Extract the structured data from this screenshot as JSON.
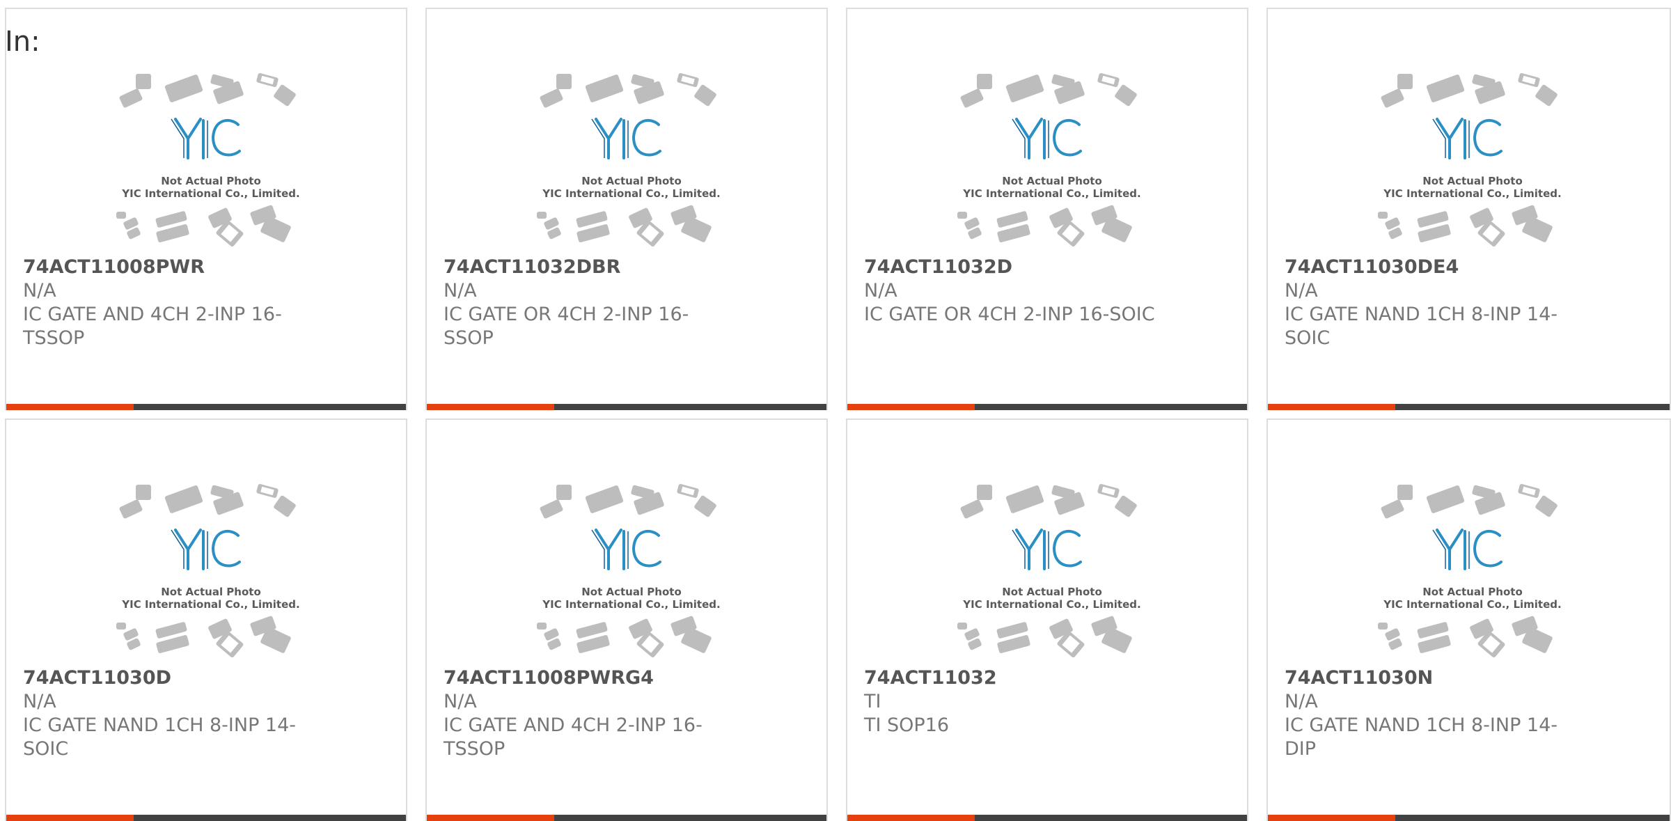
{
  "header": {
    "label": "In:"
  },
  "photo": {
    "logo_text": "YIC",
    "line1": "Not Actual Photo",
    "line2": "YIC International Co., Limited."
  },
  "colors": {
    "accent": "#e6400f",
    "bar": "#424242",
    "logo_blue": "#2a8fc4",
    "chip_gray": "#bdbdbd"
  },
  "products": [
    {
      "part_number": "74ACT11008PWR",
      "manufacturer": "N/A",
      "description": "IC GATE AND 4CH 2-INP 16-TSSOP"
    },
    {
      "part_number": "74ACT11032DBR",
      "manufacturer": "N/A",
      "description": "IC GATE OR 4CH 2-INP 16-SSOP"
    },
    {
      "part_number": "74ACT11032D",
      "manufacturer": "N/A",
      "description": "IC GATE OR 4CH 2-INP 16-SOIC"
    },
    {
      "part_number": "74ACT11030DE4",
      "manufacturer": "N/A",
      "description": "IC GATE NAND 1CH 8-INP 14-SOIC"
    },
    {
      "part_number": "74ACT11030D",
      "manufacturer": "N/A",
      "description": "IC GATE NAND 1CH 8-INP 14-SOIC"
    },
    {
      "part_number": "74ACT11008PWRG4",
      "manufacturer": "N/A",
      "description": "IC GATE AND 4CH 2-INP 16-TSSOP"
    },
    {
      "part_number": "74ACT11032",
      "manufacturer": "TI",
      "description": "TI SOP16"
    },
    {
      "part_number": "74ACT11030N",
      "manufacturer": "N/A",
      "description": "IC GATE NAND 1CH 8-INP 14-DIP"
    }
  ]
}
